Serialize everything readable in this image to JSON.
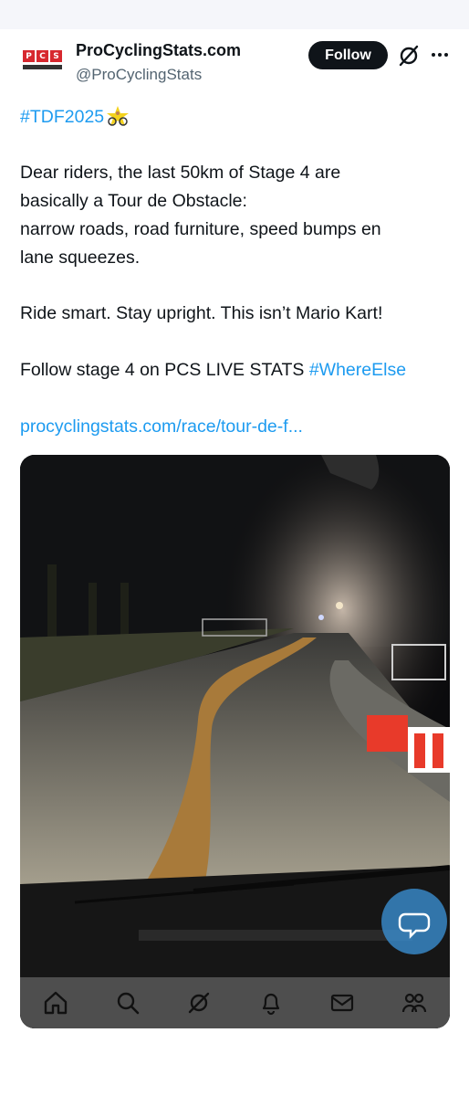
{
  "account": {
    "name": "ProCyclingStats.com",
    "handle": "@ProCyclingStats",
    "avatar_letters": [
      "P",
      "C",
      "S"
    ]
  },
  "actions": {
    "follow_label": "Follow",
    "icons": [
      "grok-icon",
      "more-icon"
    ]
  },
  "post": {
    "hashtag": "#TDF2025",
    "hashtag_emoji": "cyclist-emoji",
    "line1": "Dear riders, the last 50km of Stage 4 are",
    "line2": "basically a Tour de Obstacle:",
    "line3": "narrow roads, road furniture, speed bumps en",
    "line4": "lane squeezes.",
    "line5": "Ride smart. Stay upright. This isn’t Mario Kart!",
    "line6_text": "Follow stage 4 on PCS LIVE STATS ",
    "line6_tag": "#WhereElse",
    "link": "procyclingstats.com/race/tour-de-f..."
  },
  "media": {
    "description_icon": "night-road-photo",
    "bottom_nav": [
      "home-icon",
      "search-icon",
      "grok-icon",
      "notifications-icon",
      "messages-icon",
      "communities-icon"
    ]
  },
  "colors": {
    "accent": "#1d9bf0",
    "text": "#0f1419",
    "muted": "#536471",
    "follow_bg": "#0f1419",
    "brand_red": "#d7282f"
  }
}
